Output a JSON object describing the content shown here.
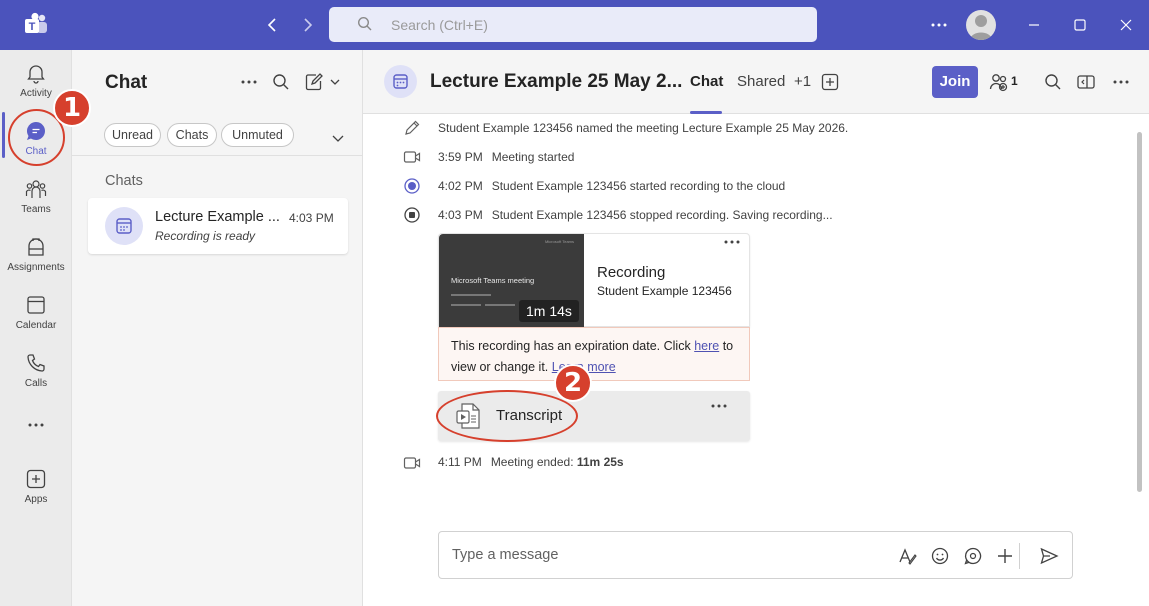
{
  "titlebar": {
    "search_placeholder": "Search (Ctrl+E)"
  },
  "rail": {
    "items": [
      {
        "label": "Activity",
        "icon": "bell-icon"
      },
      {
        "label": "Chat",
        "icon": "chat-icon"
      },
      {
        "label": "Teams",
        "icon": "teams-icon"
      },
      {
        "label": "Assignments",
        "icon": "assignments-icon"
      },
      {
        "label": "Calendar",
        "icon": "calendar-icon"
      },
      {
        "label": "Calls",
        "icon": "phone-icon"
      },
      {
        "label": "Apps",
        "icon": "plus-icon"
      }
    ]
  },
  "annotations": {
    "step1": "1",
    "step2": "2"
  },
  "chatlist": {
    "title": "Chat",
    "filters": [
      "Unread",
      "Chats",
      "Unmuted"
    ],
    "section": "Chats",
    "chats": [
      {
        "name": "Lecture Example ...",
        "time": "4:03 PM",
        "preview": "Recording is ready"
      }
    ]
  },
  "header": {
    "title": "Lecture Example 25 May 2...",
    "tabs": [
      "Chat",
      "Shared",
      "+1"
    ],
    "join": "Join",
    "participants": "1"
  },
  "messages": {
    "events": [
      {
        "icon": "pencil-icon",
        "time": "",
        "text": "Student Example 123456 named the meeting Lecture Example 25 May 2026."
      },
      {
        "icon": "video-icon",
        "time": "3:59 PM",
        "text": "Meeting started"
      },
      {
        "icon": "record-start-icon",
        "time": "4:02 PM",
        "text": "Student Example 123456 started recording to the cloud"
      },
      {
        "icon": "record-stop-icon",
        "time": "4:03 PM",
        "text": "Student Example 123456 stopped recording. Saving recording..."
      }
    ],
    "recording": {
      "thumb_title": "Microsoft Teams meeting",
      "thumb_brand": "Microsoft Teams",
      "duration": "1m 14s",
      "title": "Recording",
      "owner": "Student Example 123456",
      "warning_pre": "This recording has an expiration date. Click ",
      "warning_link1": "here",
      "warning_mid": " to view or change it. ",
      "warning_link2": "Learn more",
      "transcript": "Transcript"
    },
    "end": {
      "time": "4:11 PM",
      "text": "Meeting ended: ",
      "duration": "11m 25s"
    }
  },
  "composer": {
    "placeholder": "Type a message"
  },
  "colors": {
    "brand": "#4b53bc",
    "accent": "#5b5fc7",
    "annotation": "#d6402d"
  }
}
